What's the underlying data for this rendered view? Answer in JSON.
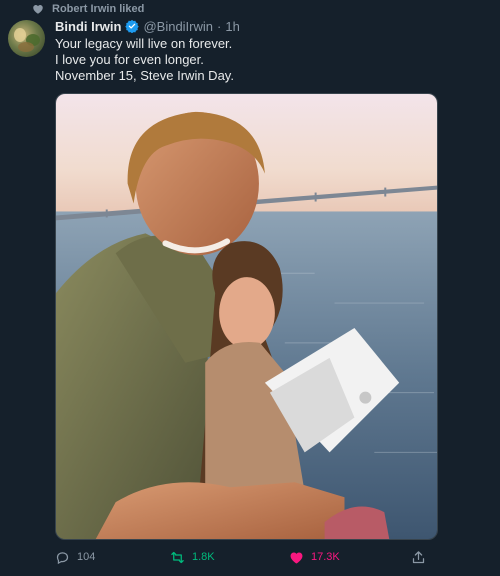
{
  "social_context": {
    "text": "Robert Irwin liked",
    "icon": "heart-icon"
  },
  "tweet": {
    "author_name": "Bindi Irwin",
    "verified": true,
    "handle": "@BindiIrwin",
    "separator": "·",
    "time": "1h",
    "lines": [
      "Your legacy will live on forever.",
      "I love you for even longer.",
      "November 15, Steve Irwin Day."
    ]
  },
  "actions": {
    "reply_count": "104",
    "retweet_count": "1.8K",
    "like_count": "17.3K",
    "liked": true,
    "retweeted": true
  },
  "colors": {
    "background": "#15202b",
    "muted": "#8b98a5",
    "retweet_green": "#00ba7c",
    "like_pink": "#f91880",
    "verified_blue": "#1d9bf0"
  }
}
